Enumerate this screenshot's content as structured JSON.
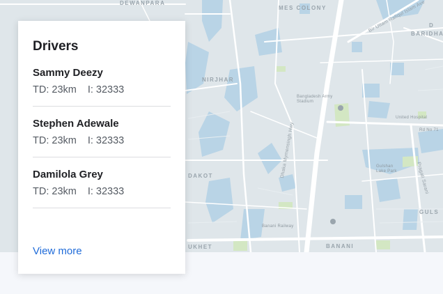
{
  "card": {
    "title": "Drivers",
    "drivers": [
      {
        "name": "Sammy Deezy",
        "td": "TD: 23km",
        "i": "I: 32333"
      },
      {
        "name": "Stephen Adewale",
        "td": "TD: 23km",
        "i": "I: 32333"
      },
      {
        "name": "Damilola Grey",
        "td": "TD: 23km",
        "i": "I: 32333"
      }
    ],
    "view_more": "View more"
  },
  "map": {
    "labels": {
      "dewanpara": "DEWANPARA",
      "mes_colony": "MES COLONY",
      "nirjhar": "NIRJHAR",
      "dakot": "DAKOT",
      "banani": "BANANI",
      "gulshan": "GULS",
      "baridhara": "BARIDHA",
      "d_label": "D",
      "ukhet": "UKHET",
      "bangladesh_army_stadium": "Bangladesh Army Stadium",
      "united_hospital": "United Hospital",
      "gulshan_lake_park": "Gulshan Lake Park",
      "banani_railway": "Banani Railway",
      "hwy": "Dhaka Mymensingh Hwy",
      "bir_uttam": "Bir Uttam Rafiqul Islam Ave",
      "pragati": "Pragati Sarani",
      "rd_no": "Rd No 71"
    },
    "colors": {
      "land": "#dfe6ea",
      "water": "#b8d4e6",
      "park": "#d4e8c4",
      "road": "#ffffff"
    }
  },
  "colors": {
    "link": "#1f6bd9",
    "title": "#1e1f24",
    "stats": "#555b63",
    "divider": "#dcdde0"
  }
}
